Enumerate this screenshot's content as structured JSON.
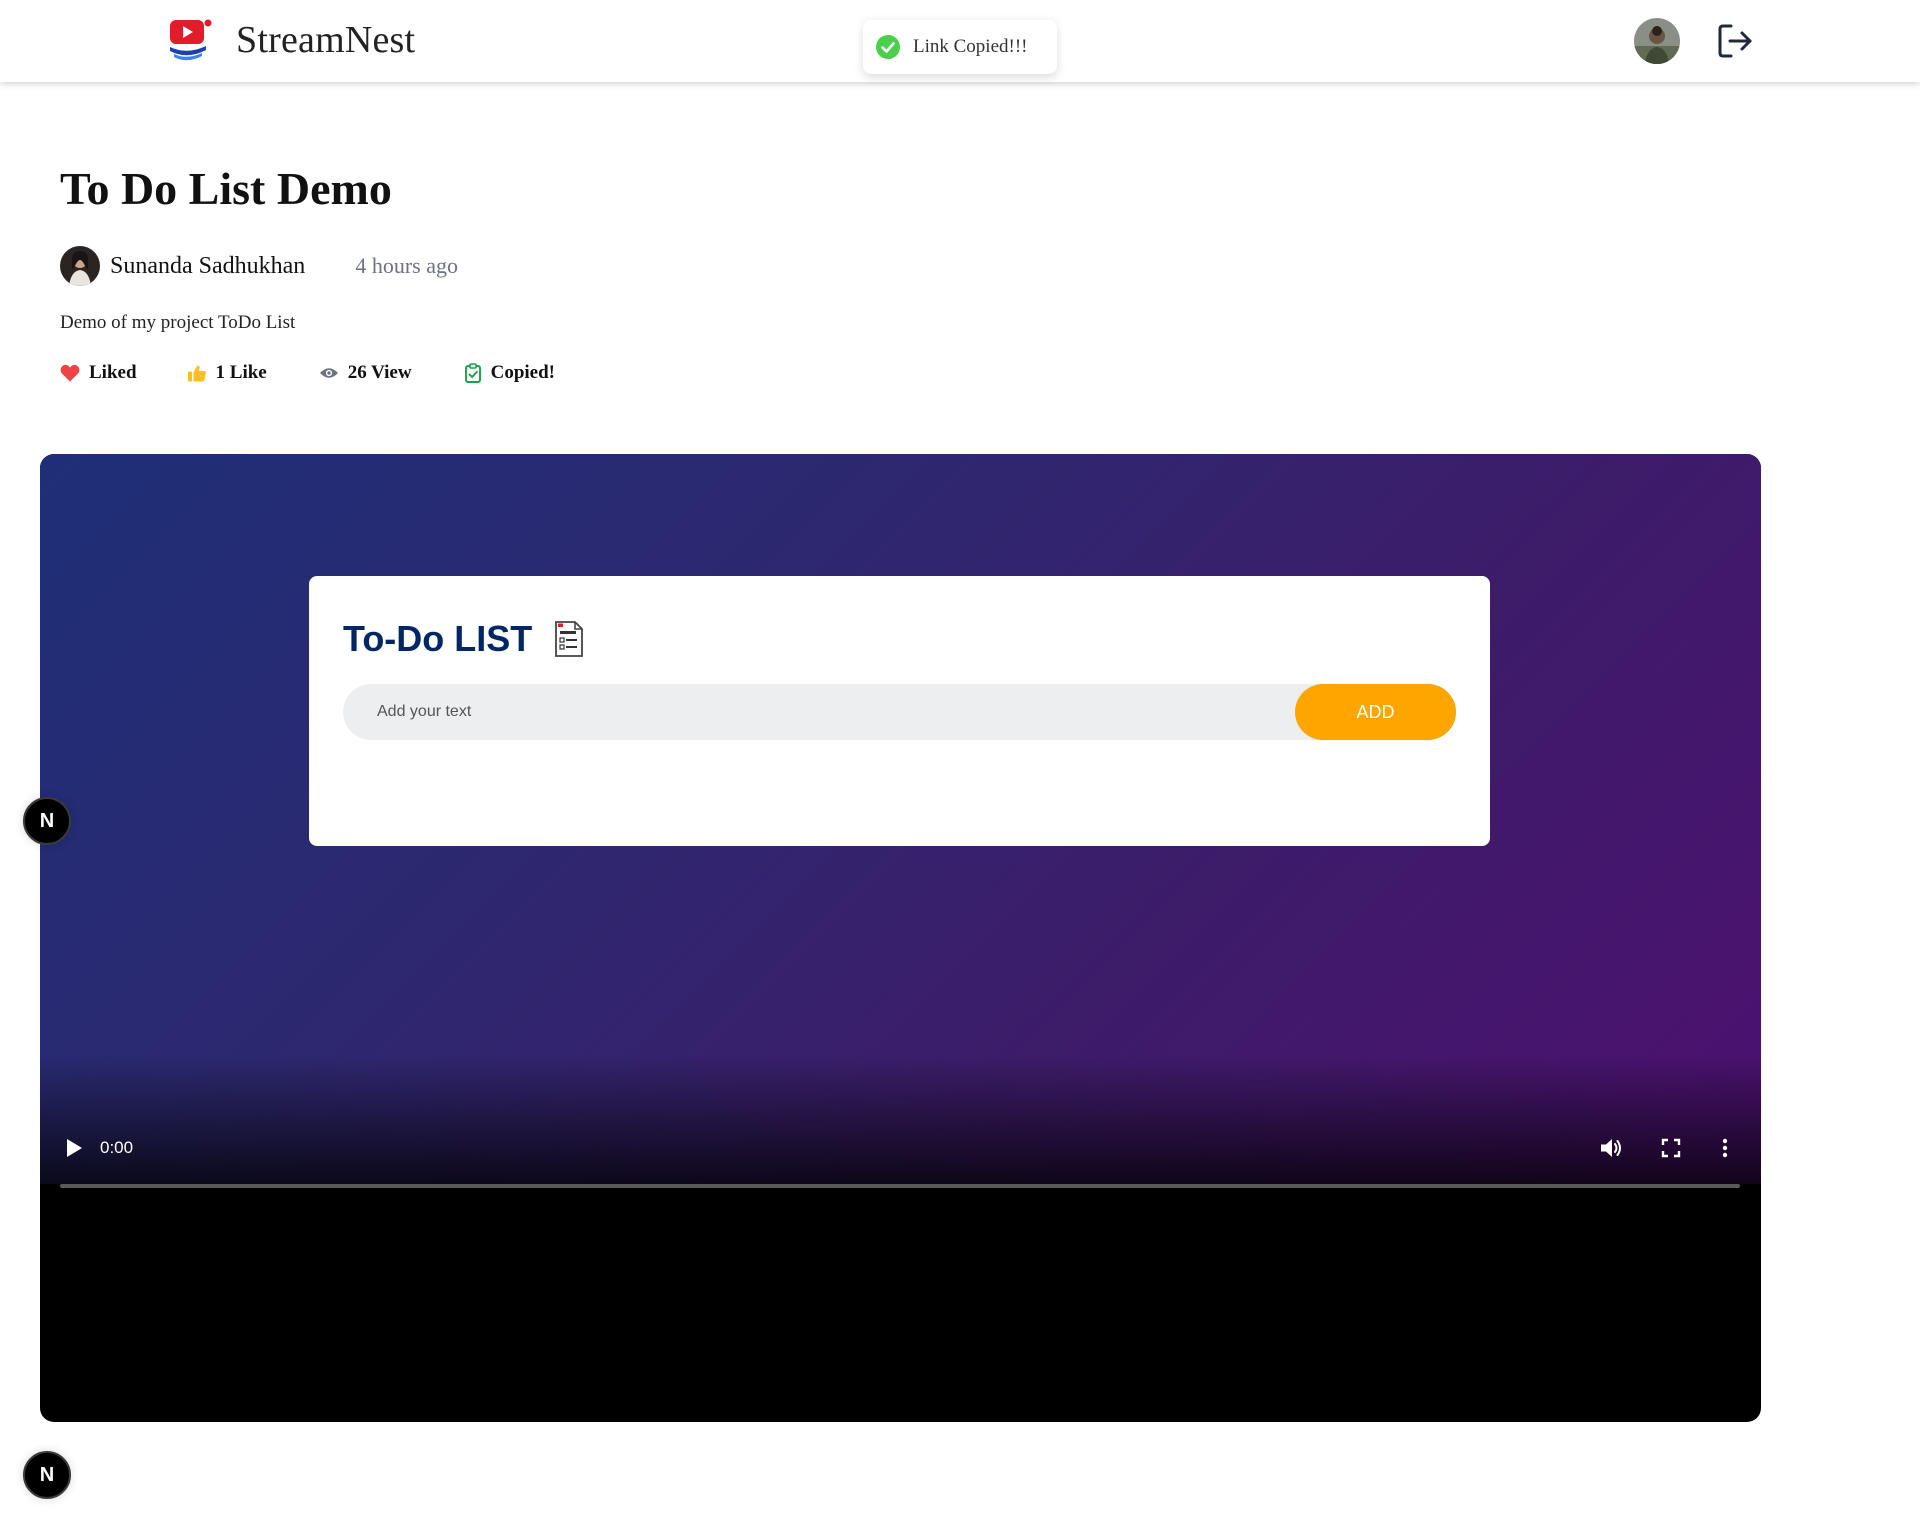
{
  "header": {
    "brand_name": "StreamNest",
    "toast_text": "Link Copied!!!"
  },
  "video": {
    "title": "To Do List Demo",
    "channel_name": "Sunanda Sadhukhan",
    "time_ago": "4 hours ago",
    "description": "Demo of my project ToDo List",
    "actions": {
      "liked_label": "Liked",
      "likes_label": "1 Like",
      "views_label": "26 View",
      "copied_label": "Copied!"
    }
  },
  "player": {
    "frame": {
      "todo_title": "To-Do LIST",
      "input_placeholder": "Add your text",
      "add_label": "ADD"
    },
    "current_time": "0:00",
    "progress_fraction": 0
  },
  "dev_badge_label": "N",
  "colors": {
    "accent_red": "#ef4444",
    "like_yellow": "#fbbf24",
    "copied_green": "#16a34a",
    "toast_green": "#4ccf4c",
    "todo_navy": "#002765",
    "add_orange": "#ffa500"
  },
  "icons": {
    "brand": "streamnest-logo-icon",
    "toast": "check-circle-icon",
    "logout": "logout-icon",
    "liked": "heart-icon",
    "like": "thumbs-up-icon",
    "view": "eye-icon",
    "copied": "clipboard-check-icon",
    "todo": "checklist-document-icon",
    "play": "play-icon",
    "volume": "volume-icon",
    "fullscreen": "fullscreen-icon",
    "more": "more-vertical-icon"
  }
}
